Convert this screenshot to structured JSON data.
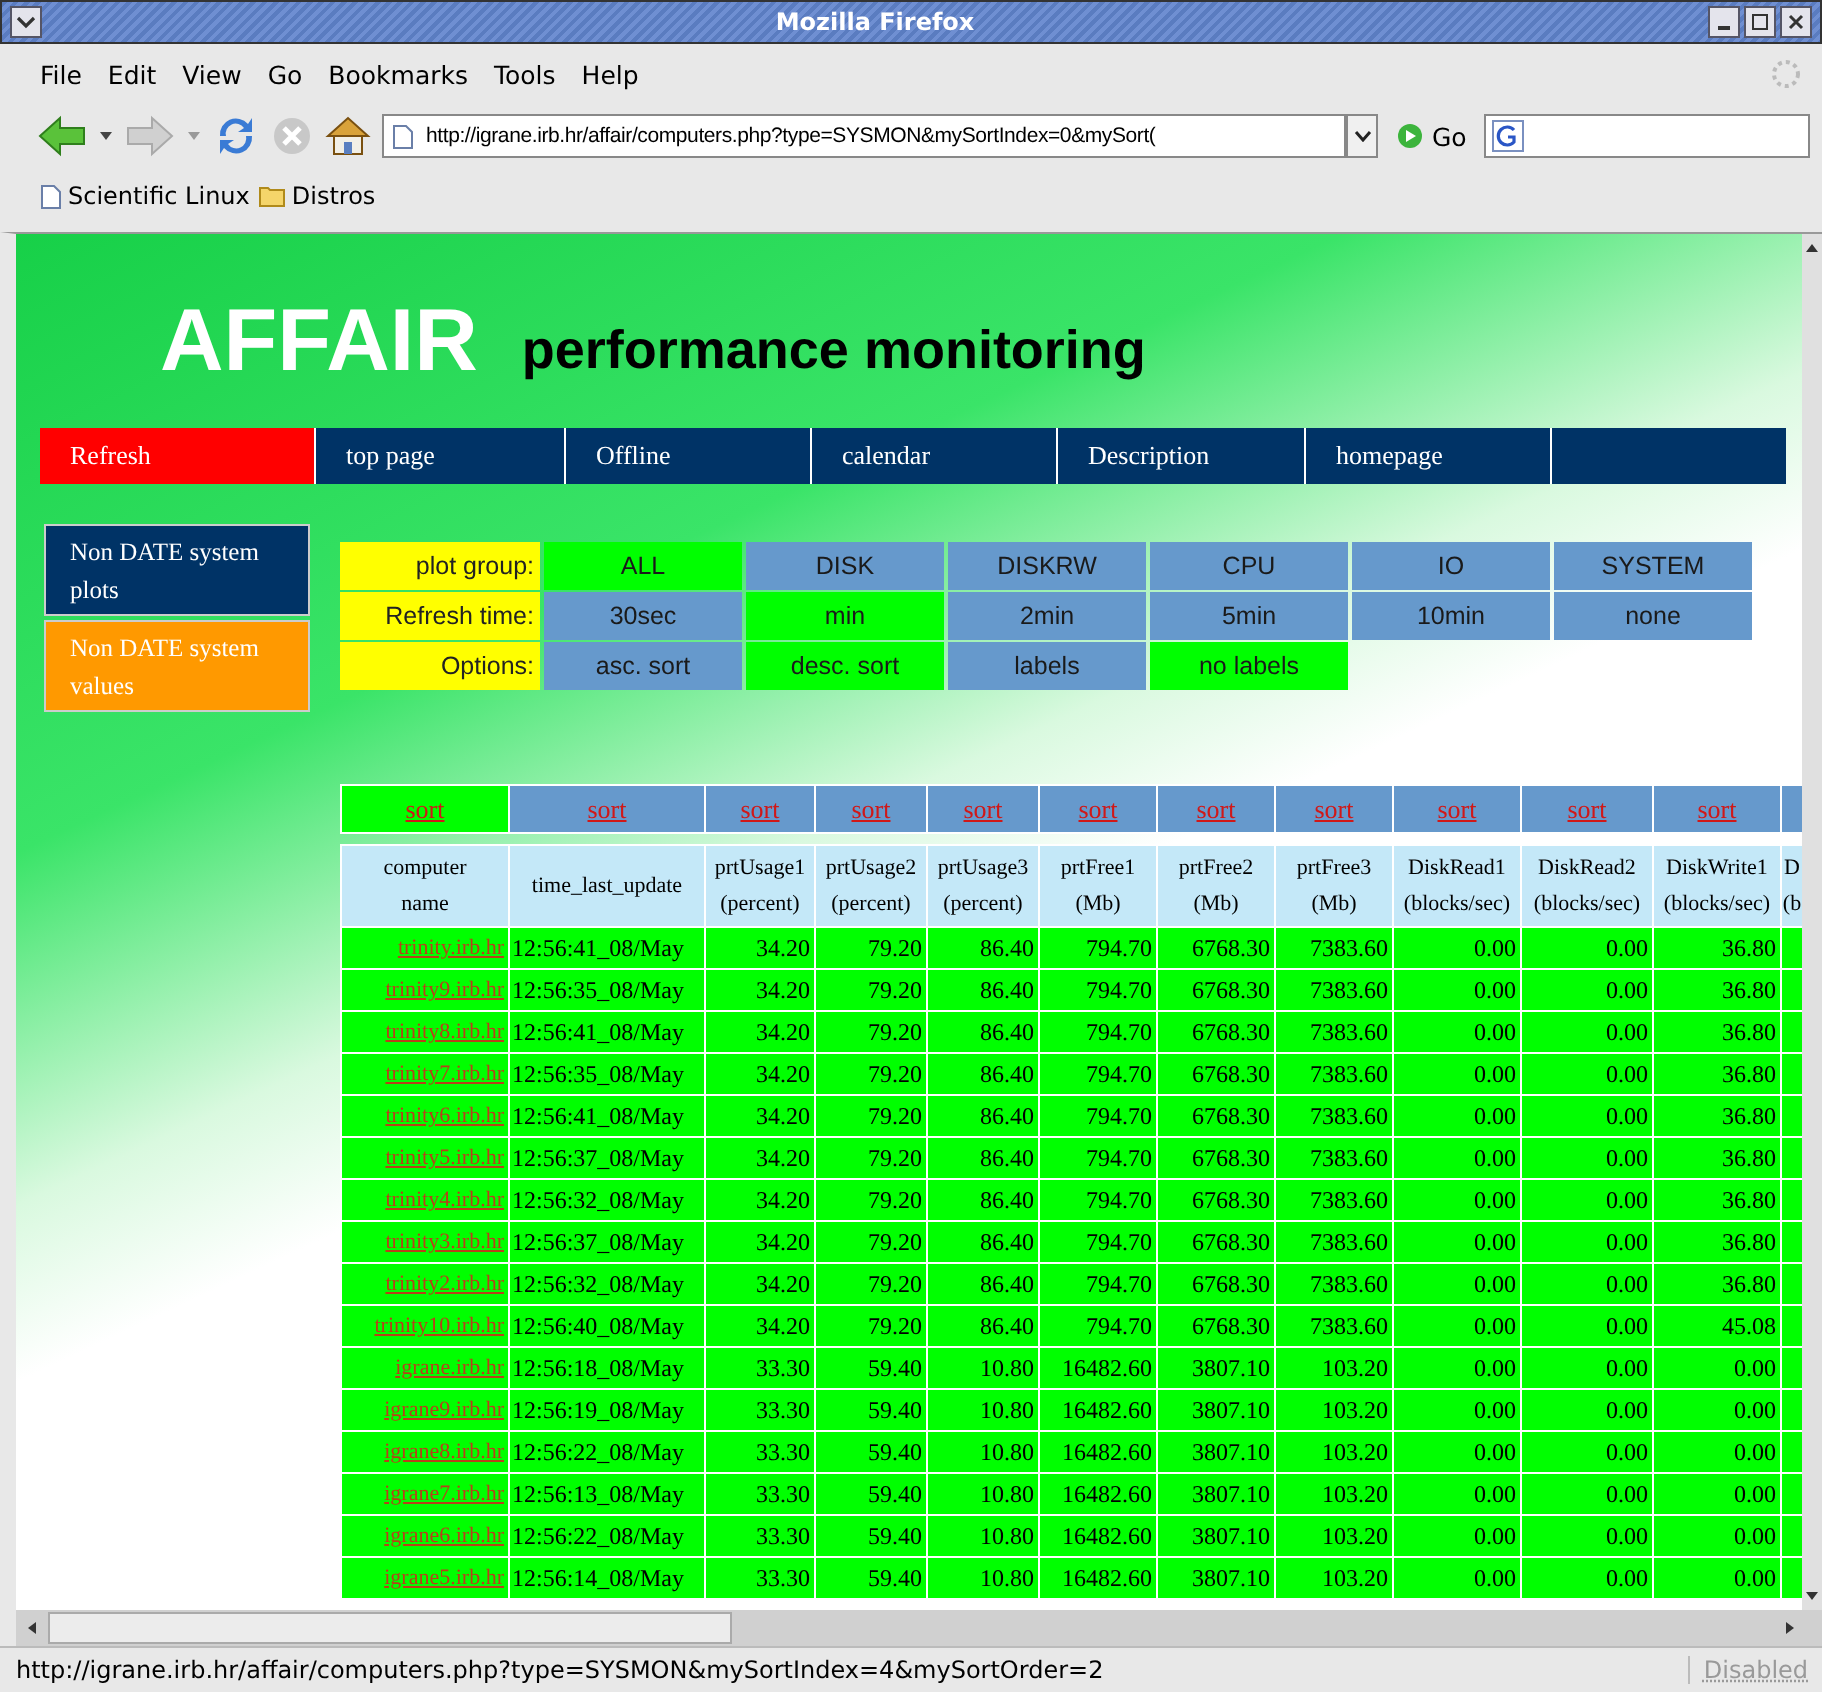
{
  "window": {
    "title": "Mozilla Firefox"
  },
  "menu": [
    "File",
    "Edit",
    "View",
    "Go",
    "Bookmarks",
    "Tools",
    "Help"
  ],
  "address_bar": {
    "value": "http://igrane.irb.hr/affair/computers.php?type=SYSMON&mySortIndex=0&mySort("
  },
  "go_button": "Go",
  "bookmarks": [
    {
      "label": "Scientific Linux",
      "kind": "page"
    },
    {
      "label": "Distros",
      "kind": "folder"
    }
  ],
  "page": {
    "logo": "AFFAIR",
    "subtitle": "performance monitoring",
    "nav": [
      {
        "label": "Refresh",
        "selected": true
      },
      {
        "label": "top page",
        "selected": false
      },
      {
        "label": "Offline",
        "selected": false
      },
      {
        "label": "calendar",
        "selected": false
      },
      {
        "label": "Description",
        "selected": false
      },
      {
        "label": "homepage",
        "selected": false
      }
    ],
    "side_menu": [
      {
        "label": "Non DATE system plots",
        "selected": false
      },
      {
        "label": "Non DATE system values",
        "selected": true
      }
    ],
    "options": [
      {
        "label": "plot group:",
        "items": [
          {
            "label": "ALL",
            "selected": true
          },
          {
            "label": "DISK",
            "selected": false
          },
          {
            "label": "DISKRW",
            "selected": false
          },
          {
            "label": "CPU",
            "selected": false
          },
          {
            "label": "IO",
            "selected": false
          },
          {
            "label": "SYSTEM",
            "selected": false
          }
        ]
      },
      {
        "label": "Refresh time:",
        "items": [
          {
            "label": "30sec",
            "selected": false
          },
          {
            "label": "min",
            "selected": true
          },
          {
            "label": "2min",
            "selected": false
          },
          {
            "label": "5min",
            "selected": false
          },
          {
            "label": "10min",
            "selected": false
          },
          {
            "label": "none",
            "selected": false
          }
        ]
      },
      {
        "label": "Options:",
        "items": [
          {
            "label": "asc. sort",
            "selected": false
          },
          {
            "label": "desc. sort",
            "selected": true
          },
          {
            "label": "labels",
            "selected": false
          },
          {
            "label": "no labels",
            "selected": true
          }
        ]
      }
    ],
    "sort_links": [
      {
        "label": "sort",
        "selected": true
      },
      {
        "label": "sort",
        "selected": false
      },
      {
        "label": "sort",
        "selected": false
      },
      {
        "label": "sort",
        "selected": false
      },
      {
        "label": "sort",
        "selected": false
      },
      {
        "label": "sort",
        "selected": false
      },
      {
        "label": "sort",
        "selected": false
      },
      {
        "label": "sort",
        "selected": false
      },
      {
        "label": "sort",
        "selected": false
      },
      {
        "label": "sort",
        "selected": false
      },
      {
        "label": "sort",
        "selected": false
      }
    ],
    "table": {
      "columns": [
        {
          "lines": [
            "computer",
            "name"
          ]
        },
        {
          "lines": [
            "time_last_update"
          ]
        },
        {
          "lines": [
            "prtUsage1",
            "(percent)"
          ]
        },
        {
          "lines": [
            "prtUsage2",
            "(percent)"
          ]
        },
        {
          "lines": [
            "prtUsage3",
            "(percent)"
          ]
        },
        {
          "lines": [
            "prtFree1",
            "(Mb)"
          ]
        },
        {
          "lines": [
            "prtFree2",
            "(Mb)"
          ]
        },
        {
          "lines": [
            "prtFree3",
            "(Mb)"
          ]
        },
        {
          "lines": [
            "DiskRead1",
            "(blocks/sec)"
          ]
        },
        {
          "lines": [
            "DiskRead2",
            "(blocks/sec)"
          ]
        },
        {
          "lines": [
            "DiskWrite1",
            "(blocks/sec)"
          ]
        },
        {
          "lines": [
            "D",
            "(b"
          ]
        }
      ],
      "rows": [
        {
          "cells": [
            "trinity.irb.hr",
            "12:56:41_08/May",
            "34.20",
            "79.20",
            "86.40",
            "794.70",
            "6768.30",
            "7383.60",
            "0.00",
            "0.00",
            "36.80"
          ]
        },
        {
          "cells": [
            "trinity9.irb.hr",
            "12:56:35_08/May",
            "34.20",
            "79.20",
            "86.40",
            "794.70",
            "6768.30",
            "7383.60",
            "0.00",
            "0.00",
            "36.80"
          ]
        },
        {
          "cells": [
            "trinity8.irb.hr",
            "12:56:41_08/May",
            "34.20",
            "79.20",
            "86.40",
            "794.70",
            "6768.30",
            "7383.60",
            "0.00",
            "0.00",
            "36.80"
          ]
        },
        {
          "cells": [
            "trinity7.irb.hr",
            "12:56:35_08/May",
            "34.20",
            "79.20",
            "86.40",
            "794.70",
            "6768.30",
            "7383.60",
            "0.00",
            "0.00",
            "36.80"
          ]
        },
        {
          "cells": [
            "trinity6.irb.hr",
            "12:56:41_08/May",
            "34.20",
            "79.20",
            "86.40",
            "794.70",
            "6768.30",
            "7383.60",
            "0.00",
            "0.00",
            "36.80"
          ]
        },
        {
          "cells": [
            "trinity5.irb.hr",
            "12:56:37_08/May",
            "34.20",
            "79.20",
            "86.40",
            "794.70",
            "6768.30",
            "7383.60",
            "0.00",
            "0.00",
            "36.80"
          ]
        },
        {
          "cells": [
            "trinity4.irb.hr",
            "12:56:32_08/May",
            "34.20",
            "79.20",
            "86.40",
            "794.70",
            "6768.30",
            "7383.60",
            "0.00",
            "0.00",
            "36.80"
          ]
        },
        {
          "cells": [
            "trinity3.irb.hr",
            "12:56:37_08/May",
            "34.20",
            "79.20",
            "86.40",
            "794.70",
            "6768.30",
            "7383.60",
            "0.00",
            "0.00",
            "36.80"
          ]
        },
        {
          "cells": [
            "trinity2.irb.hr",
            "12:56:32_08/May",
            "34.20",
            "79.20",
            "86.40",
            "794.70",
            "6768.30",
            "7383.60",
            "0.00",
            "0.00",
            "36.80"
          ]
        },
        {
          "cells": [
            "trinity10.irb.hr",
            "12:56:40_08/May",
            "34.20",
            "79.20",
            "86.40",
            "794.70",
            "6768.30",
            "7383.60",
            "0.00",
            "0.00",
            "45.08"
          ]
        },
        {
          "cells": [
            "igrane.irb.hr",
            "12:56:18_08/May",
            "33.30",
            "59.40",
            "10.80",
            "16482.60",
            "3807.10",
            "103.20",
            "0.00",
            "0.00",
            "0.00"
          ]
        },
        {
          "cells": [
            "igrane9.irb.hr",
            "12:56:19_08/May",
            "33.30",
            "59.40",
            "10.80",
            "16482.60",
            "3807.10",
            "103.20",
            "0.00",
            "0.00",
            "0.00"
          ]
        },
        {
          "cells": [
            "igrane8.irb.hr",
            "12:56:22_08/May",
            "33.30",
            "59.40",
            "10.80",
            "16482.60",
            "3807.10",
            "103.20",
            "0.00",
            "0.00",
            "0.00"
          ]
        },
        {
          "cells": [
            "igrane7.irb.hr",
            "12:56:13_08/May",
            "33.30",
            "59.40",
            "10.80",
            "16482.60",
            "3807.10",
            "103.20",
            "0.00",
            "0.00",
            "0.00"
          ]
        },
        {
          "cells": [
            "igrane6.irb.hr",
            "12:56:22_08/May",
            "33.30",
            "59.40",
            "10.80",
            "16482.60",
            "3807.10",
            "103.20",
            "0.00",
            "0.00",
            "0.00"
          ]
        },
        {
          "cells": [
            "igrane5.irb.hr",
            "12:56:14_08/May",
            "33.30",
            "59.40",
            "10.80",
            "16482.60",
            "3807.10",
            "103.20",
            "0.00",
            "0.00",
            "0.00"
          ]
        }
      ]
    }
  },
  "status_bar": {
    "text": "http://igrane.irb.hr/affair/computers.php?type=SYSMON&mySortIndex=4&mySortOrder=2",
    "right": "Disabled"
  }
}
